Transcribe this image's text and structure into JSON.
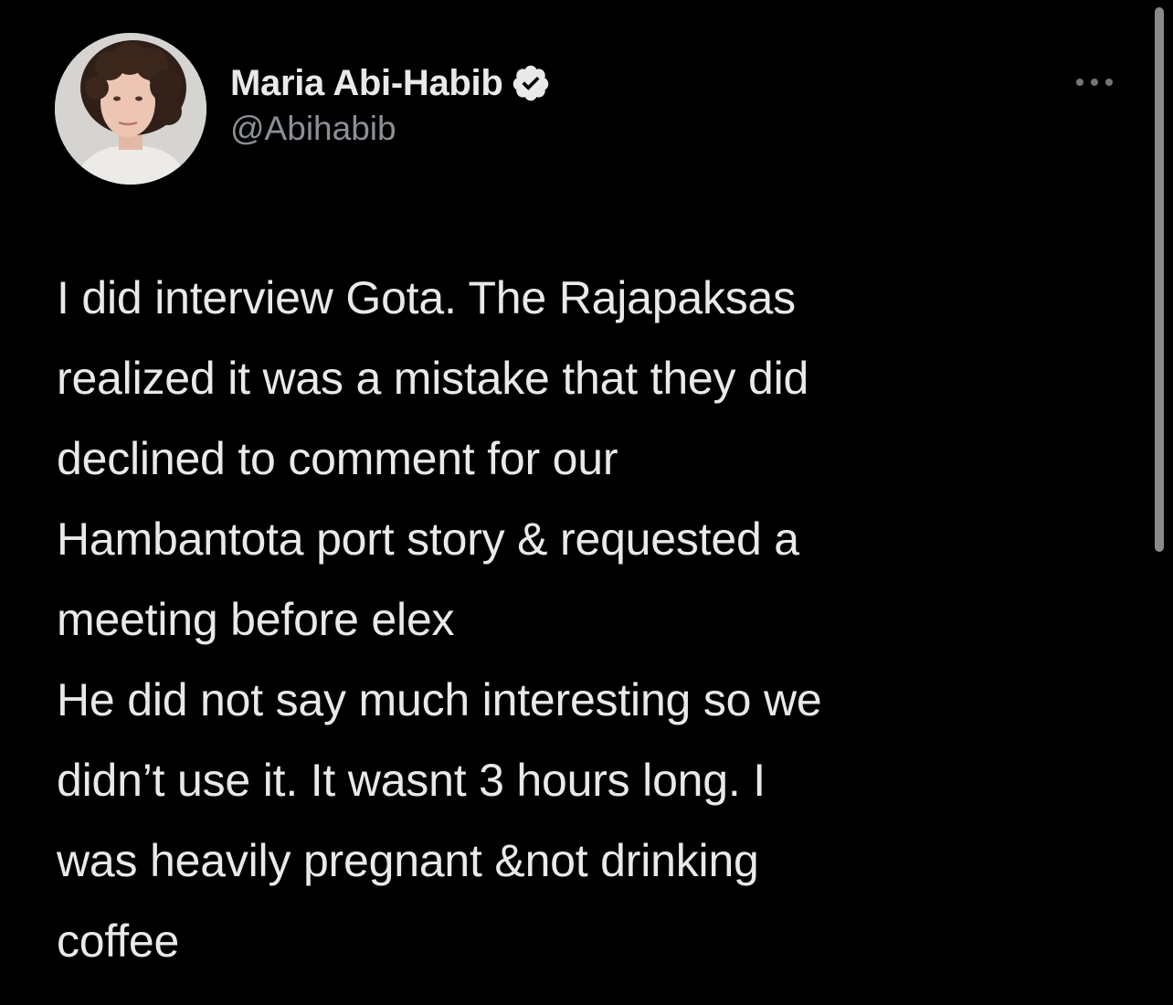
{
  "author": {
    "display_name": "Maria Abi-Habib",
    "handle": "@Abihabib",
    "verified": true,
    "avatar_icon": "profile-photo"
  },
  "tweet": {
    "text": "I did interview Gota. The Rajapaksas\nrealized it was a mistake that they did\ndeclined to comment for our\nHambantota port story & requested a\nmeeting before elex\nHe did not say much interesting so we\ndidn’t use it. It wasnt 3 hours long. I\nwas heavily pregnant &not drinking\ncoffee"
  },
  "icons": {
    "verified": "verified-badge-icon",
    "more": "more-options-icon"
  },
  "colors": {
    "background": "#000000",
    "text_primary": "#e7e9ea",
    "text_secondary": "#8b9096"
  }
}
